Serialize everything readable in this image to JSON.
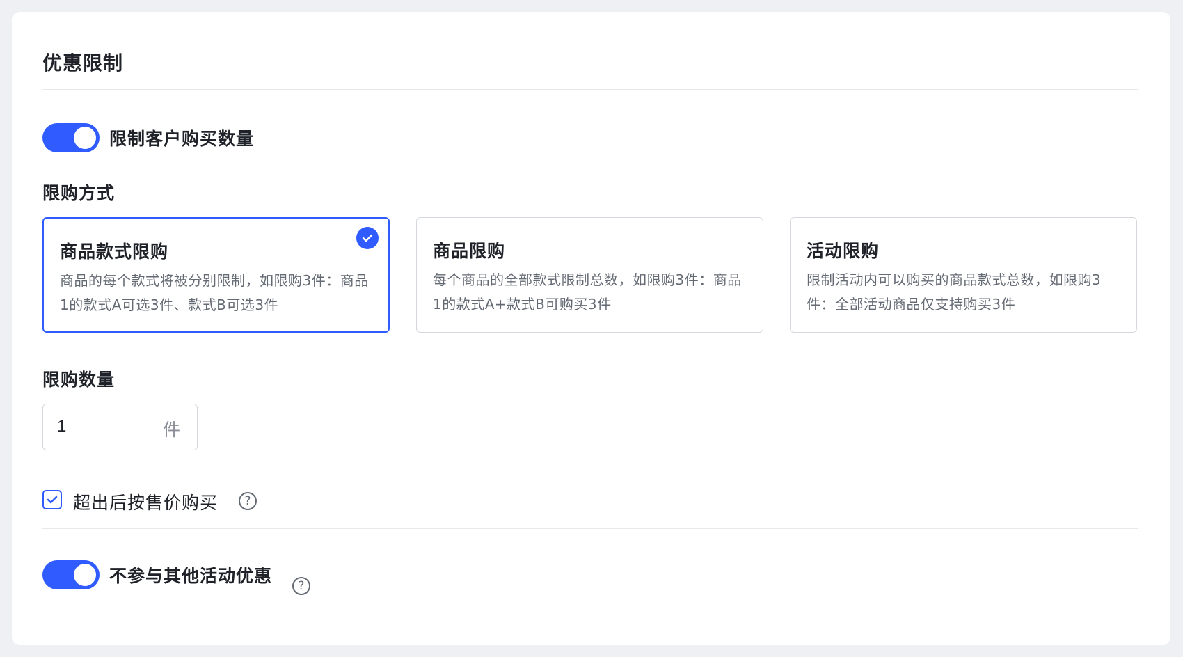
{
  "section_title": "优惠限制",
  "limit_toggle": {
    "label": "限制客户购买数量",
    "on": true
  },
  "limit_method": {
    "label": "限购方式",
    "options": [
      {
        "title": "商品款式限购",
        "desc": "商品的每个款式将被分别限制，如限购3件：商品1的款式A可选3件、款式B可选3件",
        "selected": true
      },
      {
        "title": "商品限购",
        "desc": "每个商品的全部款式限制总数，如限购3件：商品1的款式A+款式B可购买3件",
        "selected": false
      },
      {
        "title": "活动限购",
        "desc": "限制活动内可以购买的商品款式总数，如限购3件：全部活动商品仅支持购买3件",
        "selected": false
      }
    ]
  },
  "limit_quantity": {
    "label": "限购数量",
    "value": "1",
    "unit": "件"
  },
  "overflow_checkbox": {
    "label": "超出后按售价购买",
    "checked": true,
    "help": "?"
  },
  "exclude_toggle": {
    "label": "不参与其他活动优惠",
    "on": true,
    "help": "?"
  },
  "colors": {
    "accent": "#2f5bff",
    "border": "#d5d8dd",
    "muted": "#646a73"
  }
}
